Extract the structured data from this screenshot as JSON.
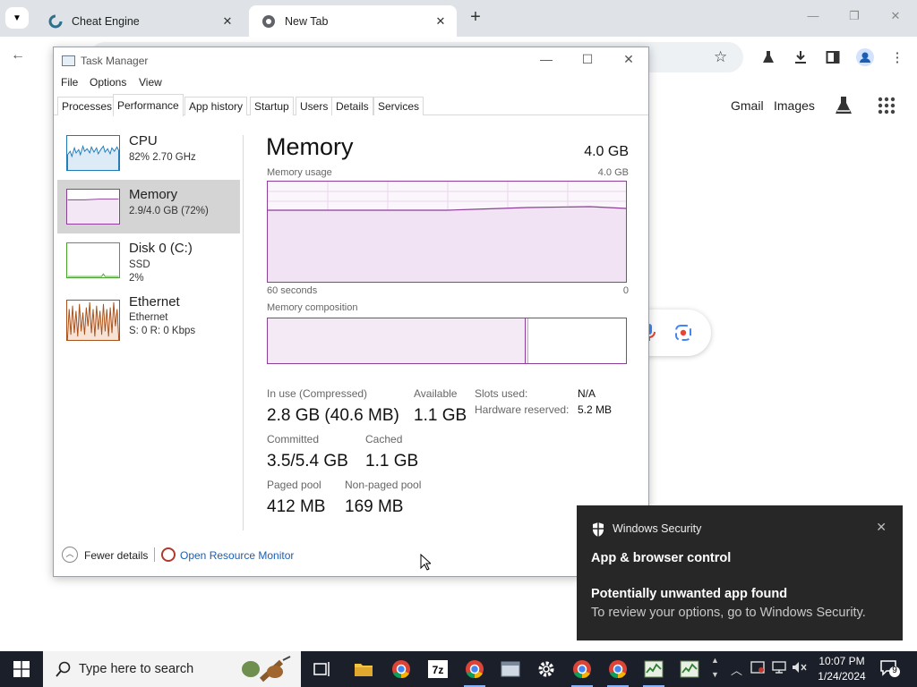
{
  "browser": {
    "tabs": [
      {
        "title": "Cheat Engine"
      },
      {
        "title": "New Tab"
      }
    ],
    "google": {
      "gmail": "Gmail",
      "images": "Images"
    }
  },
  "task_manager": {
    "title": "Task Manager",
    "menu": [
      "File",
      "Options",
      "View"
    ],
    "tabs": [
      "Processes",
      "Performance",
      "App history",
      "Startup",
      "Users",
      "Details",
      "Services"
    ],
    "active_tab": "Performance",
    "sidebar": [
      {
        "name": "CPU",
        "line1": "82%  2.70 GHz",
        "line2": "",
        "color": "#1f7ab8"
      },
      {
        "name": "Memory",
        "line1": "2.9/4.0 GB (72%)",
        "line2": "",
        "color": "#8b3f96"
      },
      {
        "name": "Disk 0 (C:)",
        "line1": "SSD",
        "line2": "2%",
        "color": "#4aa52e"
      },
      {
        "name": "Ethernet",
        "line1": "Ethernet",
        "line2": "S: 0  R: 0 Kbps",
        "color": "#a7501a"
      }
    ],
    "memory": {
      "heading": "Memory",
      "total": "4.0 GB",
      "usage_label": "Memory usage",
      "usage_max": "4.0 GB",
      "time_left": "60 seconds",
      "time_right": "0",
      "composition_label": "Memory composition",
      "usage_fraction": 0.72,
      "stats": {
        "in_use_label": "In use (Compressed)",
        "in_use": "2.8 GB (40.6 MB)",
        "available_label": "Available",
        "available": "1.1 GB",
        "slots_label": "Slots used:",
        "slots": "N/A",
        "hw_label": "Hardware reserved:",
        "hw": "5.2 MB",
        "committed_label": "Committed",
        "committed": "3.5/5.4 GB",
        "cached_label": "Cached",
        "cached": "1.1 GB",
        "paged_label": "Paged pool",
        "paged": "412 MB",
        "nonpaged_label": "Non-paged pool",
        "nonpaged": "169 MB"
      }
    },
    "footer": {
      "fewer": "Fewer details",
      "resource_monitor": "Open Resource Monitor"
    }
  },
  "toast": {
    "source": "Windows Security",
    "heading": "App & browser control",
    "title": "Potentially unwanted app found",
    "body": "To review your options, go to Windows Security."
  },
  "taskbar": {
    "search_placeholder": "Type here to search",
    "time": "10:07 PM",
    "date": "1/24/2024",
    "notification_count": "9"
  }
}
